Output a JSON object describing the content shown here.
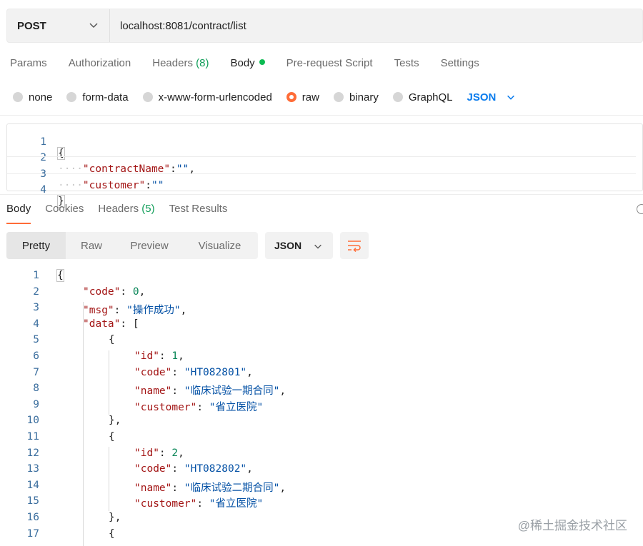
{
  "request": {
    "method": "POST",
    "url": "localhost:8081/contract/list"
  },
  "request_tabs": [
    {
      "label": "Params"
    },
    {
      "label": "Authorization"
    },
    {
      "label": "Headers",
      "count": "(8)"
    },
    {
      "label": "Body"
    },
    {
      "label": "Pre-request Script"
    },
    {
      "label": "Tests"
    },
    {
      "label": "Settings"
    }
  ],
  "body_types": [
    {
      "label": "none"
    },
    {
      "label": "form-data"
    },
    {
      "label": "x-www-form-urlencoded"
    },
    {
      "label": "raw",
      "selected": true
    },
    {
      "label": "binary"
    },
    {
      "label": "GraphQL"
    }
  ],
  "raw_format": "JSON",
  "request_body": {
    "line_numbers": [
      "1",
      "2",
      "3",
      "4"
    ],
    "open_brace": "{",
    "close_brace": "}",
    "indent_dots": "····",
    "fields": [
      {
        "key": "\"contractName\"",
        "colon": ":",
        "value": "\"\"",
        "comma": ","
      },
      {
        "key": "\"customer\"",
        "colon": ":",
        "value": "\"\"",
        "comma": ""
      }
    ]
  },
  "response_tabs": [
    {
      "label": "Body"
    },
    {
      "label": "Cookies"
    },
    {
      "label": "Headers",
      "count": "(5)"
    },
    {
      "label": "Test Results"
    }
  ],
  "view_modes": [
    "Pretty",
    "Raw",
    "Preview",
    "Visualize"
  ],
  "response_format": "JSON",
  "response_body": {
    "line_numbers": [
      "1",
      "2",
      "3",
      "4",
      "5",
      "6",
      "7",
      "8",
      "9",
      "10",
      "11",
      "12",
      "13",
      "14",
      "15",
      "16",
      "17"
    ],
    "code_key": "\"code\"",
    "code_value": "0",
    "msg_key": "\"msg\"",
    "msg_value": "\"操作成功\"",
    "data_key": "\"data\"",
    "items": [
      {
        "id_key": "\"id\"",
        "id_value": "1",
        "code_key": "\"code\"",
        "code_value": "\"HT082801\"",
        "name_key": "\"name\"",
        "name_value": "\"临床试验一期合同\"",
        "customer_key": "\"customer\"",
        "customer_value": "\"省立医院\""
      },
      {
        "id_key": "\"id\"",
        "id_value": "2",
        "code_key": "\"code\"",
        "code_value": "\"HT082802\"",
        "name_key": "\"name\"",
        "name_value": "\"临床试验二期合同\"",
        "customer_key": "\"customer\"",
        "customer_value": "\"省立医院\""
      }
    ]
  },
  "watermark": "@稀土掘金技术社区",
  "colors": {
    "accent_orange": "#ff6c37",
    "json_blue": "#097bed",
    "count_green": "#0f9d58",
    "key_red": "#a31515",
    "string_blue": "#0451a5",
    "number_green": "#098658"
  }
}
